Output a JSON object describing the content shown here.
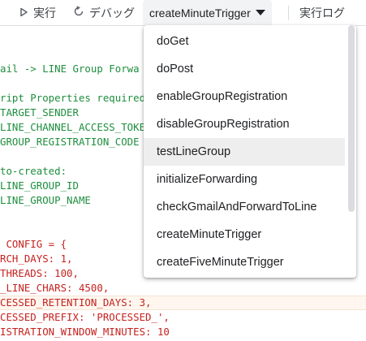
{
  "toolbar": {
    "run_label": "実行",
    "debug_label": "デバッグ",
    "selected_function": "createMinuteTrigger",
    "log_label": "実行ログ"
  },
  "code_lines": [
    "",
    "",
    "ail -> LINE Group Forwa",
    "",
    "ript Properties required",
    "TARGET_SENDER",
    "LINE_CHANNEL_ACCESS_TOKE",
    "GROUP_REGISTRATION_CODE",
    "",
    "to-created:",
    "LINE_GROUP_ID",
    "LINE_GROUP_NAME",
    "",
    "",
    " CONFIG = {",
    "RCH_DAYS: 1,",
    "THREADS: 100,",
    "_LINE_CHARS: 4500,",
    "CESSED_RETENTION_DAYS: 3,",
    "CESSED_PREFIX: 'PROCESSED_',",
    "ISTRATION_WINDOW_MINUTES: 10"
  ],
  "dropdown": {
    "items": [
      "doGet",
      "doPost",
      "enableGroupRegistration",
      "disableGroupRegistration",
      "testLineGroup",
      "initializeForwarding",
      "checkGmailAndForwardToLine",
      "createMinuteTrigger",
      "createFiveMinuteTrigger"
    ],
    "hovered_item": "testLineGroup"
  },
  "colors": {
    "comment": "#1e8e3e",
    "identifier": "#c5221f",
    "number": "#1a73e8",
    "string": "#b3261e"
  }
}
